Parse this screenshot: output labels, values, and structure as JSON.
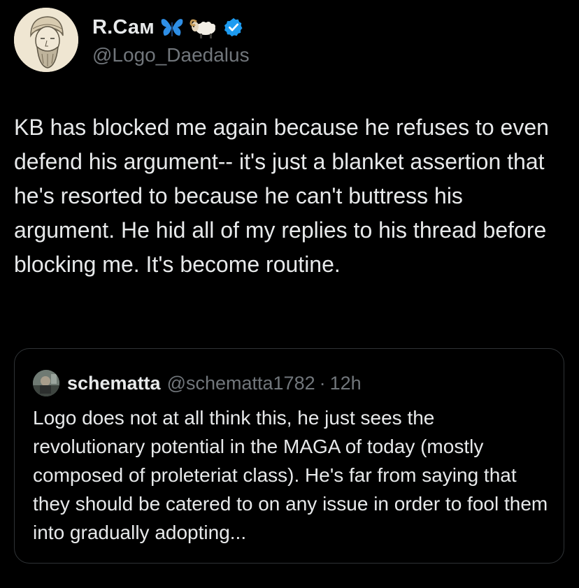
{
  "post": {
    "author": {
      "display_name": "R.Сам",
      "handle": "@Logo_Daedalus",
      "name_emojis": [
        "butterfly-emoji",
        "ram-emoji"
      ],
      "verified_badge": "verified-badge-icon"
    },
    "text": "KB has blocked me again because he refuses to even defend his argument-- it's just a blanket assertion that he's resorted to because he can't buttress his argument. He hid all of my replies to his thread before blocking me. It's become routine.",
    "quoted_post": {
      "display_name": "schematta",
      "handle": "@schematta1782",
      "separator": "·",
      "time": "12h",
      "text": "Logo does not at all think this, he just sees the revolutionary potential in the MAGA of today (mostly composed of proleteriat class). He's far from saying that they should be catered to on any issue in order to fool them into gradually adopting..."
    }
  },
  "colors": {
    "background": "#000000",
    "primary_text": "#e7e9ea",
    "secondary_text": "#71767b",
    "border": "#2f3336",
    "verified_blue": "#1d9bf0",
    "butterfly_blue": "#2f8fe6"
  }
}
